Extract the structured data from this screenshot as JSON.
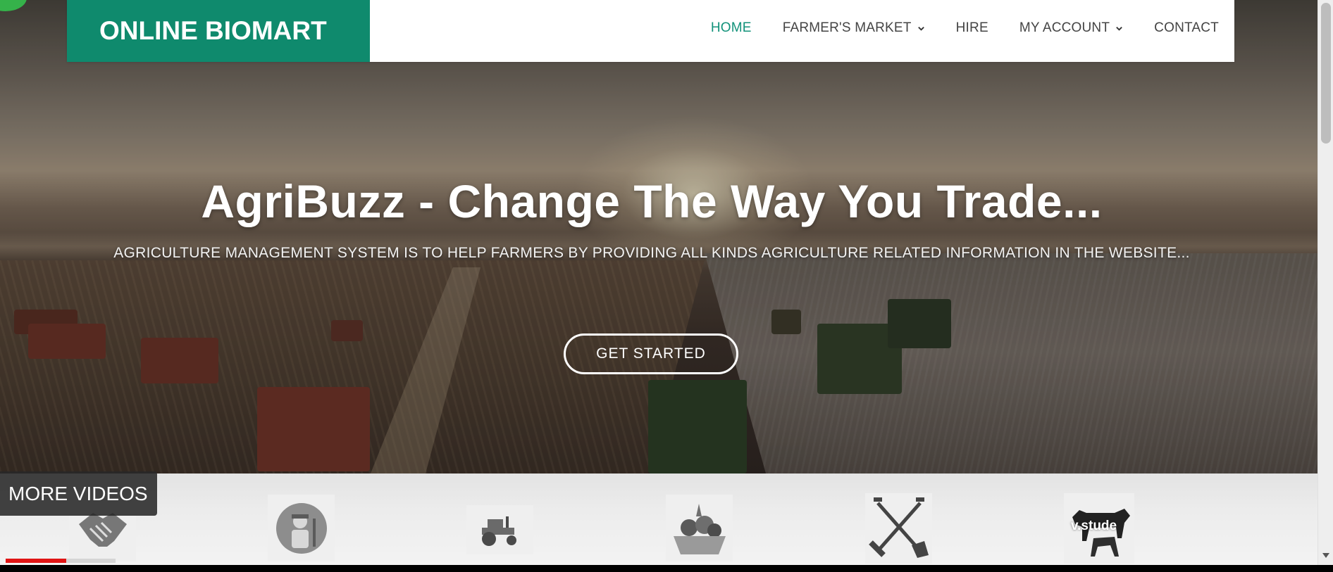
{
  "brand": {
    "name": "ONLINE BIOMART",
    "color": "#0f8a6d"
  },
  "nav": {
    "items": [
      {
        "label": "HOME",
        "active": true,
        "dropdown": false
      },
      {
        "label": "FARMER'S MARKET",
        "active": false,
        "dropdown": true
      },
      {
        "label": "HIRE",
        "active": false,
        "dropdown": false
      },
      {
        "label": "MY ACCOUNT",
        "active": false,
        "dropdown": true
      },
      {
        "label": "CONTACT",
        "active": false,
        "dropdown": false
      }
    ],
    "active_color": "#12927a"
  },
  "hero": {
    "title": "AgriBuzz - Change The Way You Trade...",
    "subtitle": "AGRICULTURE MANAGEMENT SYSTEM IS TO HELP FARMERS BY PROVIDING ALL KINDS AGRICULTURE RELATED INFORMATION IN THE WEBSITE...",
    "cta_label": "GET STARTED"
  },
  "services": [
    {
      "icon": "handshake-icon"
    },
    {
      "icon": "farmer-icon"
    },
    {
      "icon": "tractor-icon"
    },
    {
      "icon": "fruit-basket-icon"
    },
    {
      "icon": "shovel-rake-icon"
    },
    {
      "icon": "livestock-icon"
    }
  ],
  "player": {
    "more_videos_label": "MORE VIDEOS",
    "watermark_text": "v.stude",
    "progress_fraction": 0.55
  }
}
